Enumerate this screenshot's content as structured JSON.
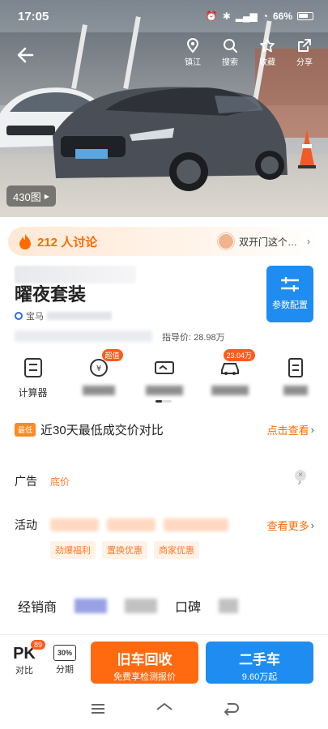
{
  "status_bar": {
    "time": "17:05",
    "battery": "66%"
  },
  "top_nav": {
    "items": [
      {
        "label": "镇江",
        "icon": "location-icon"
      },
      {
        "label": "搜索",
        "icon": "search-icon"
      },
      {
        "label": "收藏",
        "icon": "star-icon"
      },
      {
        "label": "分享",
        "icon": "share-icon"
      }
    ]
  },
  "gallery": {
    "count_label": "430图"
  },
  "discussion": {
    "count": "212 人讨论",
    "topic": "双开门这个…"
  },
  "car": {
    "name": "曜夜套装",
    "brand": "宝马",
    "guide_price": "指导价: 28.98万"
  },
  "param_button": {
    "label": "参数配置"
  },
  "tools": [
    {
      "label": "计算器",
      "badge": ""
    },
    {
      "label": "",
      "badge": "超值"
    },
    {
      "label": "",
      "badge": ""
    },
    {
      "label": "",
      "badge": "23.04万"
    },
    {
      "label": "",
      "badge": ""
    }
  ],
  "card": {
    "lowest": {
      "tag": "最低",
      "text": "近30天最低成交价对比",
      "link": "点击查看"
    },
    "ad": {
      "label": "广告",
      "sub": "底价"
    },
    "activity": {
      "label": "活动",
      "more": "查看更多",
      "pills": [
        "劲爆福利",
        "置换优惠",
        "商家优惠"
      ]
    }
  },
  "tabs": {
    "dealer": "经销商",
    "koubei": "口碑"
  },
  "bottom_bar": {
    "pk_label": "PK",
    "pk_sub": "对比",
    "pk_badge": "89",
    "installment_label": "分期",
    "installment_icon_text": "30%",
    "trade_in": {
      "title": "旧车回收",
      "sub": "免费享检测报价"
    },
    "used_car": {
      "title": "二手车",
      "sub": "9.60万起"
    }
  },
  "colors": {
    "orange": "#ff6a00",
    "blue": "#1e8cf0"
  }
}
